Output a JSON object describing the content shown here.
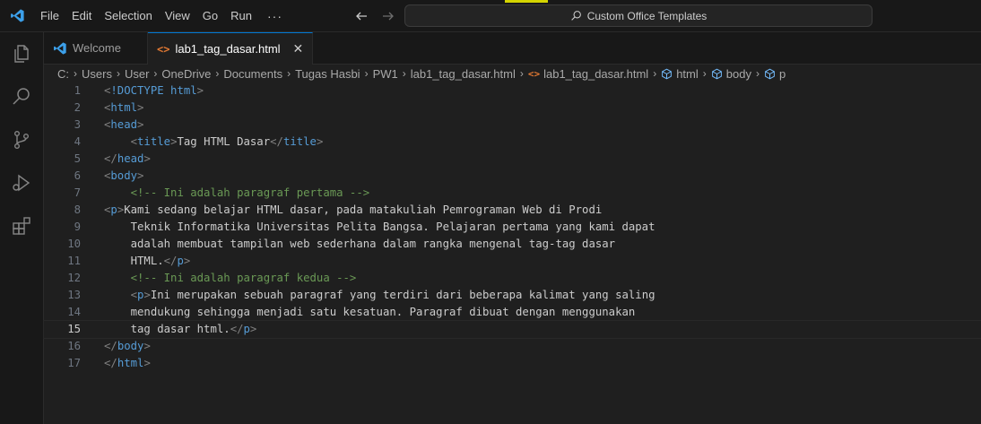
{
  "titlebar": {
    "menus": [
      "File",
      "Edit",
      "Selection",
      "View",
      "Go",
      "Run"
    ],
    "more": "···",
    "search_text": "Custom Office Templates"
  },
  "tabs": [
    {
      "label": "Welcome",
      "icon": "vscode-icon",
      "active": false
    },
    {
      "label": "lab1_tag_dasar.html",
      "icon": "html-file-icon",
      "active": true,
      "close": "✕"
    }
  ],
  "breadcrumb": {
    "folders": [
      "C:",
      "Users",
      "User",
      "OneDrive",
      "Documents",
      "Tugas Hasbi",
      "PW1",
      "lab1_tag_dasar.html"
    ],
    "file": "lab1_tag_dasar.html",
    "symbols": [
      "html",
      "body",
      "p"
    ]
  },
  "editor": {
    "current_line": 15,
    "lines": [
      {
        "n": "1",
        "indent": "",
        "tokens": [
          [
            "b",
            "<"
          ],
          [
            "d",
            "!DOCTYPE "
          ],
          [
            "t",
            "html"
          ],
          [
            "b",
            ">"
          ]
        ]
      },
      {
        "n": "2",
        "indent": "",
        "tokens": [
          [
            "b",
            "<"
          ],
          [
            "t",
            "html"
          ],
          [
            "b",
            ">"
          ]
        ]
      },
      {
        "n": "3",
        "indent": "",
        "tokens": [
          [
            "b",
            "<"
          ],
          [
            "t",
            "head"
          ],
          [
            "b",
            ">"
          ]
        ]
      },
      {
        "n": "4",
        "indent": "    ",
        "tokens": [
          [
            "b",
            "<"
          ],
          [
            "t",
            "title"
          ],
          [
            "b",
            ">"
          ],
          [
            "x",
            "Tag HTML Dasar"
          ],
          [
            "b",
            "</"
          ],
          [
            "t",
            "title"
          ],
          [
            "b",
            ">"
          ]
        ]
      },
      {
        "n": "5",
        "indent": "",
        "tokens": [
          [
            "b",
            "</"
          ],
          [
            "t",
            "head"
          ],
          [
            "b",
            ">"
          ]
        ]
      },
      {
        "n": "6",
        "indent": "",
        "tokens": [
          [
            "b",
            "<"
          ],
          [
            "t",
            "body"
          ],
          [
            "b",
            ">"
          ]
        ]
      },
      {
        "n": "7",
        "indent": "    ",
        "tokens": [
          [
            "c",
            "<!-- Ini adalah paragraf pertama -->"
          ]
        ]
      },
      {
        "n": "8",
        "indent": "",
        "tokens": [
          [
            "b",
            "<"
          ],
          [
            "t",
            "p"
          ],
          [
            "b",
            ">"
          ],
          [
            "x",
            "Kami sedang belajar HTML dasar, pada matakuliah Pemrograman Web di Prodi"
          ]
        ]
      },
      {
        "n": "9",
        "indent": "    ",
        "tokens": [
          [
            "x",
            "Teknik Informatika Universitas Pelita Bangsa. Pelajaran pertama yang kami dapat"
          ]
        ]
      },
      {
        "n": "10",
        "indent": "    ",
        "tokens": [
          [
            "x",
            "adalah membuat tampilan web sederhana dalam rangka mengenal tag-tag dasar"
          ]
        ]
      },
      {
        "n": "11",
        "indent": "    ",
        "tokens": [
          [
            "x",
            "HTML."
          ],
          [
            "b",
            "</"
          ],
          [
            "t",
            "p"
          ],
          [
            "b",
            ">"
          ]
        ]
      },
      {
        "n": "12",
        "indent": "    ",
        "tokens": [
          [
            "c",
            "<!-- Ini adalah paragraf kedua -->"
          ]
        ]
      },
      {
        "n": "13",
        "indent": "    ",
        "tokens": [
          [
            "b",
            "<"
          ],
          [
            "t",
            "p"
          ],
          [
            "b",
            ">"
          ],
          [
            "x",
            "Ini merupakan sebuah paragraf yang terdiri dari beberapa kalimat yang saling"
          ]
        ]
      },
      {
        "n": "14",
        "indent": "    ",
        "tokens": [
          [
            "x",
            "mendukung sehingga menjadi satu kesatuan. Paragraf dibuat dengan menggunakan"
          ]
        ]
      },
      {
        "n": "15",
        "indent": "    ",
        "tokens": [
          [
            "x",
            "tag dasar html."
          ],
          [
            "b",
            "</"
          ],
          [
            "t",
            "p"
          ],
          [
            "b",
            ">"
          ]
        ]
      },
      {
        "n": "16",
        "indent": "",
        "tokens": [
          [
            "b",
            "</"
          ],
          [
            "t",
            "body"
          ],
          [
            "b",
            ">"
          ]
        ]
      },
      {
        "n": "17",
        "indent": "",
        "tokens": [
          [
            "b",
            "</"
          ],
          [
            "t",
            "html"
          ],
          [
            "b",
            ">"
          ]
        ]
      }
    ]
  },
  "colors": {
    "accent": "#0078d4",
    "html_icon": "#e37933",
    "vscode_icon": "#3ca0ea",
    "tag": "#569cd6",
    "comment": "#6a9955"
  }
}
